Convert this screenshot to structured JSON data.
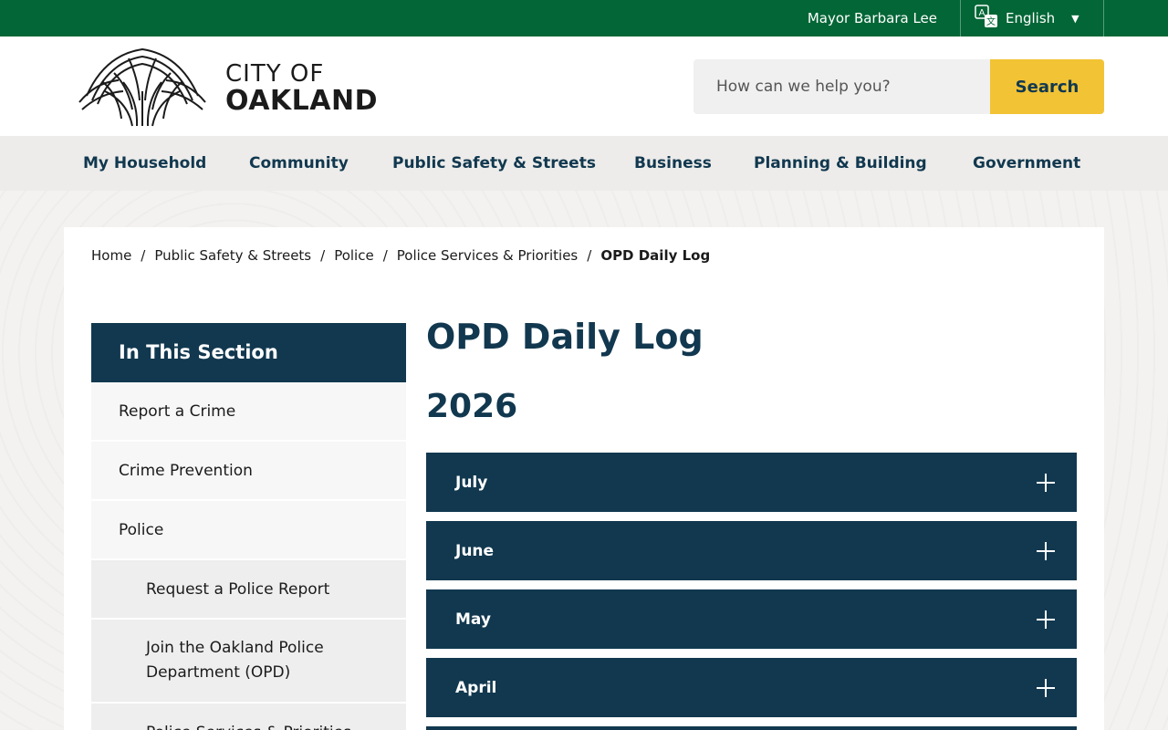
{
  "topbar": {
    "mayor": "Mayor Barbara Lee",
    "language": "English"
  },
  "logo": {
    "line1": "CITY OF",
    "line2": "OAKLAND"
  },
  "search": {
    "placeholder": "How can we help you?",
    "button": "Search"
  },
  "nav": [
    "My Household",
    "Community",
    "Public Safety & Streets",
    "Business",
    "Planning & Building",
    "Government"
  ],
  "breadcrumb": [
    "Home",
    "Public Safety & Streets",
    "Police",
    "Police Services & Priorities"
  ],
  "breadcrumb_current": "OPD Daily Log",
  "sidebar": {
    "title": "In This Section",
    "items": [
      "Report a Crime",
      "Crime Prevention",
      "Police"
    ],
    "subitems": [
      "Request a Police Report",
      "Join the Oakland Police Department (OPD)",
      "Police Services & Priorities"
    ]
  },
  "page": {
    "title": "OPD Daily Log",
    "year": "2026"
  },
  "accordion": [
    "July",
    "June",
    "May",
    "April"
  ],
  "colors": {
    "topbar": "#026636",
    "navy": "#11384f",
    "accent": "#f2c334"
  }
}
